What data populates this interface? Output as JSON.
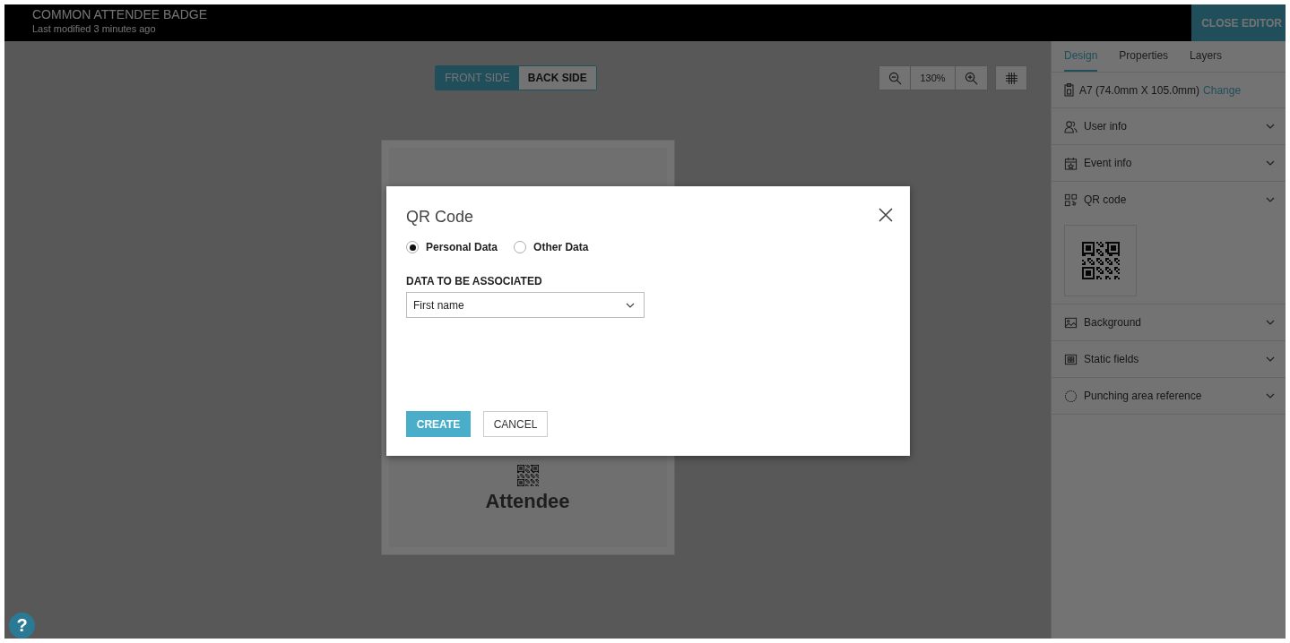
{
  "header": {
    "title": "COMMON ATTENDEE BADGE",
    "subtitle": "Last modified 3 minutes ago",
    "close_button": "CLOSE EDITOR"
  },
  "side_toggle": [
    {
      "label": "FRONT SIDE",
      "selected": true
    },
    {
      "label": "BACK SIDE",
      "selected": false
    }
  ],
  "zoom": {
    "value": "130%"
  },
  "badge": {
    "text": "Attendee"
  },
  "sidebar": {
    "tabs": [
      {
        "label": "Design",
        "selected": true
      },
      {
        "label": "Properties",
        "selected": false
      },
      {
        "label": "Layers",
        "selected": false
      }
    ],
    "size": {
      "text": "A7 (74.0mm X 105.0mm)",
      "link": "Change"
    },
    "sections": [
      {
        "label": "User info",
        "kind": "user"
      },
      {
        "label": "Event info",
        "kind": "event"
      },
      {
        "label": "QR code",
        "kind": "qr"
      },
      {
        "label": "Background",
        "kind": "background"
      },
      {
        "label": "Static fields",
        "kind": "static"
      },
      {
        "label": "Punching area reference",
        "kind": "punch"
      }
    ]
  },
  "dialog": {
    "title": "QR Code",
    "options": [
      {
        "label": "Personal Data",
        "selected": true
      },
      {
        "label": "Other Data",
        "selected": false
      }
    ],
    "field_label": "DATA TO BE ASSOCIATED",
    "select": {
      "value": "First name"
    },
    "buttons": [
      {
        "label": "CREATE",
        "kind": "primary"
      },
      {
        "label": "CANCEL",
        "kind": "secondary"
      }
    ]
  },
  "help": {
    "label": "?"
  }
}
